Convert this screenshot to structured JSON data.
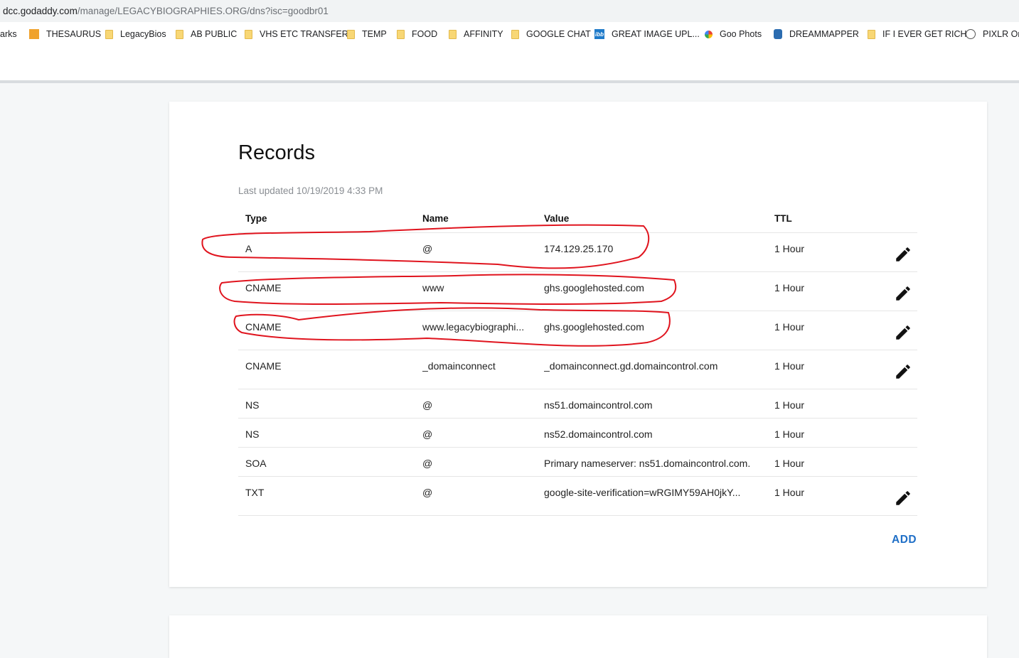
{
  "browser": {
    "url_host": "dcc.godaddy.com",
    "url_path": "/manage/LEGACYBIOGRAPHIES.ORG/dns?isc=goodbr01",
    "bookmarks": [
      {
        "label": "arks",
        "icon": "none"
      },
      {
        "label": "THESAURUS",
        "icon": "thesaurus-icon"
      },
      {
        "label": "LegacyBios",
        "icon": "folder-icon"
      },
      {
        "label": "AB PUBLIC",
        "icon": "folder-icon"
      },
      {
        "label": "VHS ETC TRANSFER",
        "icon": "folder-icon"
      },
      {
        "label": "TEMP",
        "icon": "folder-icon"
      },
      {
        "label": "FOOD",
        "icon": "folder-icon"
      },
      {
        "label": "AFFINITY",
        "icon": "folder-icon"
      },
      {
        "label": "GOOGLE CHAT",
        "icon": "folder-icon"
      },
      {
        "label": "GREAT IMAGE UPL...",
        "icon": "ibb-icon"
      },
      {
        "label": "Goo Phots",
        "icon": "google-photos-icon"
      },
      {
        "label": "DREAMMAPPER",
        "icon": "dreammapper-icon"
      },
      {
        "label": "IF I EVER GET RICH",
        "icon": "folder-icon"
      },
      {
        "label": "PIXLR Onl",
        "icon": "pixlr-icon"
      }
    ]
  },
  "records": {
    "title": "Records",
    "last_updated": "Last updated 10/19/2019 4:33 PM",
    "columns": {
      "type": "Type",
      "name": "Name",
      "value": "Value",
      "ttl": "TTL"
    },
    "rows": [
      {
        "type": "A",
        "name": "@",
        "value": "174.129.25.170",
        "ttl": "1 Hour",
        "editable": true
      },
      {
        "type": "CNAME",
        "name": "www",
        "value": "ghs.googlehosted.com",
        "ttl": "1 Hour",
        "editable": true
      },
      {
        "type": "CNAME",
        "name": "www.legacybiographi...",
        "value": "ghs.googlehosted.com",
        "ttl": "1 Hour",
        "editable": true
      },
      {
        "type": "CNAME",
        "name": "_domainconnect",
        "value": "_domainconnect.gd.domaincontrol.com",
        "ttl": "1 Hour",
        "editable": true
      },
      {
        "type": "NS",
        "name": "@",
        "value": "ns51.domaincontrol.com",
        "ttl": "1 Hour",
        "editable": false
      },
      {
        "type": "NS",
        "name": "@",
        "value": "ns52.domaincontrol.com",
        "ttl": "1 Hour",
        "editable": false
      },
      {
        "type": "SOA",
        "name": "@",
        "value": "Primary nameserver: ns51.domaincontrol.com.",
        "ttl": "1 Hour",
        "editable": false
      },
      {
        "type": "TXT",
        "name": "@",
        "value": "google-site-verification=wRGIMY59AH0jkY...",
        "ttl": "1 Hour",
        "editable": true
      }
    ],
    "add_label": "ADD",
    "edit_icon": "pencil-icon"
  },
  "colors": {
    "accent": "#1f6fc7",
    "annotation": "#e0141e",
    "page_bg": "#f5f7f8"
  }
}
